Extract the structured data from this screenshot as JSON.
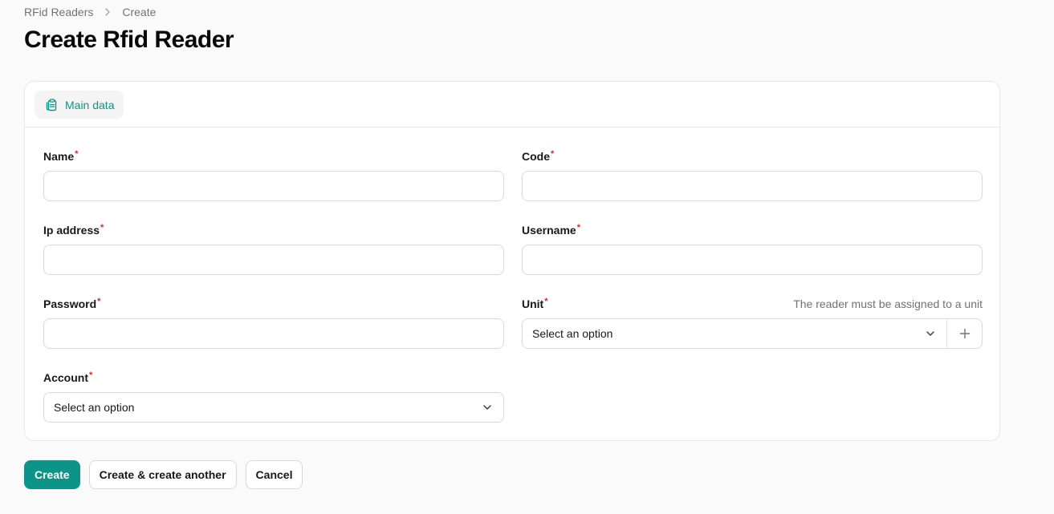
{
  "breadcrumb": {
    "parent": "RFid Readers",
    "current": "Create"
  },
  "page_title": "Create Rfid Reader",
  "tabs": [
    {
      "label": "Main data",
      "icon": "clipboard-document-icon"
    }
  ],
  "fields": {
    "name": {
      "label": "Name",
      "required_mark": "*",
      "value": ""
    },
    "code": {
      "label": "Code",
      "required_mark": "*",
      "value": ""
    },
    "ip_address": {
      "label": "Ip address",
      "required_mark": "*",
      "value": ""
    },
    "username": {
      "label": "Username",
      "required_mark": "*",
      "value": ""
    },
    "password": {
      "label": "Password",
      "required_mark": "*",
      "value": ""
    },
    "unit": {
      "label": "Unit",
      "required_mark": "*",
      "hint": "The reader must be assigned to a unit",
      "value": "Select an option"
    },
    "account": {
      "label": "Account",
      "required_mark": "*",
      "value": "Select an option"
    }
  },
  "actions": {
    "create": "Create",
    "create_another": "Create & create another",
    "cancel": "Cancel"
  },
  "colors": {
    "primary": "#0d9488",
    "required": "#dc2626",
    "muted": "#71717a",
    "border": "#d9d9dc"
  }
}
